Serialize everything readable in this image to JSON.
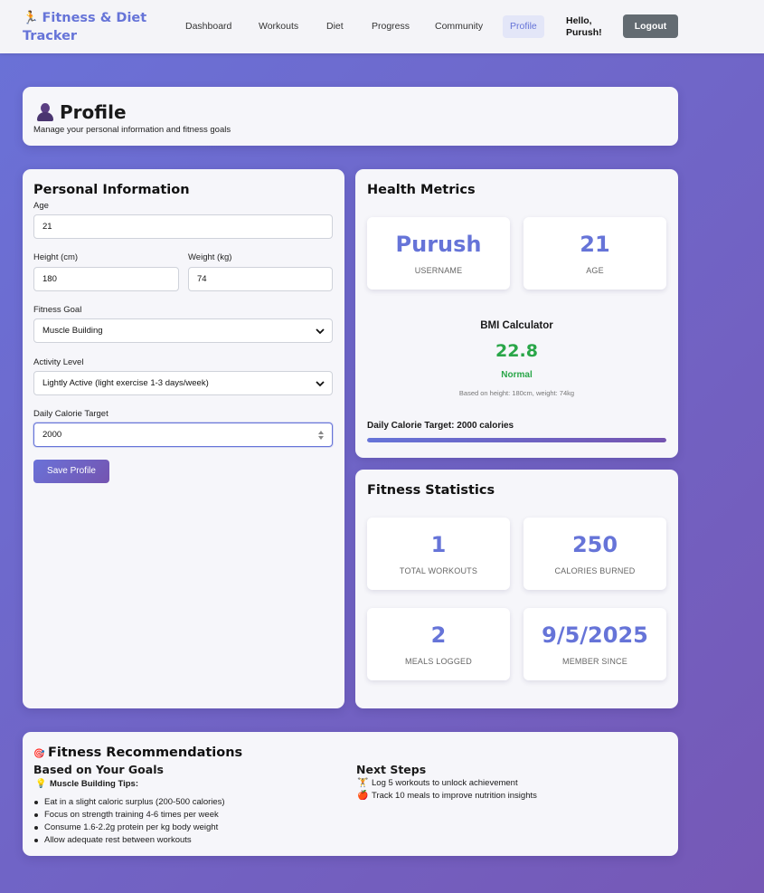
{
  "header": {
    "brand": "Fitness & Diet Tracker",
    "nav": [
      "Dashboard",
      "Workouts",
      "Diet",
      "Progress",
      "Community",
      "Profile"
    ],
    "active_nav": "Profile",
    "greeting_line1": "Hello,",
    "greeting_line2": "Purush!",
    "logout": "Logout"
  },
  "profile_header": {
    "title": "Profile",
    "subtitle": "Manage your personal information and fitness goals"
  },
  "personal_info": {
    "title": "Personal Information",
    "age_label": "Age",
    "age_value": "21",
    "height_label": "Height (cm)",
    "height_value": "180",
    "weight_label": "Weight (kg)",
    "weight_value": "74",
    "goal_label": "Fitness Goal",
    "goal_value": "Muscle Building",
    "activity_label": "Activity Level",
    "activity_value": "Lightly Active (light exercise 1-3 days/week)",
    "calorie_label": "Daily Calorie Target",
    "calorie_value": "2000",
    "save_button": "Save Profile"
  },
  "health_metrics": {
    "title": "Health Metrics",
    "username_value": "Purush",
    "username_label": "USERNAME",
    "age_value": "21",
    "age_label": "AGE",
    "bmi_title": "BMI Calculator",
    "bmi_value": "22.8",
    "bmi_status": "Normal",
    "bmi_note": "Based on height: 180cm, weight: 74kg",
    "calorie_target_text": "Daily Calorie Target: 2000 calories",
    "calorie_progress": 1.0
  },
  "fitness_stats": {
    "title": "Fitness Statistics",
    "stats": [
      {
        "value": "1",
        "label": "TOTAL WORKOUTS"
      },
      {
        "value": "250",
        "label": "CALORIES BURNED"
      },
      {
        "value": "2",
        "label": "MEALS LOGGED"
      },
      {
        "value": "9/5/2025",
        "label": "MEMBER SINCE"
      }
    ]
  },
  "recommendations": {
    "title": "Fitness Recommendations",
    "goals_title": "Based on Your Goals",
    "tips_heading": "Muscle Building Tips:",
    "tips": [
      "Eat in a slight caloric surplus (200-500 calories)",
      "Focus on strength training 4-6 times per week",
      "Consume 1.6-2.2g protein per kg body weight",
      "Allow adequate rest between workouts"
    ],
    "next_title": "Next Steps",
    "steps": [
      "Log 5 workouts to unlock achievement",
      "Track 10 meals to improve nutrition insights"
    ]
  },
  "colors": {
    "accent": "#6674d8",
    "success": "#29a648",
    "background_start": "#6a72d8",
    "background_end": "#7658b6"
  }
}
